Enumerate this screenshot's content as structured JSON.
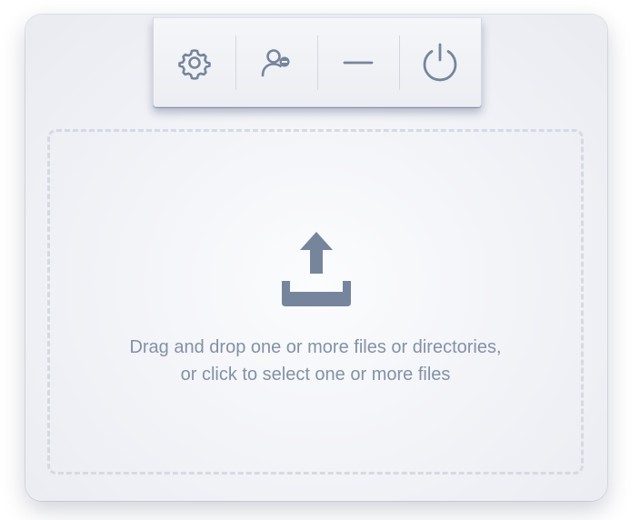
{
  "toolbar": {
    "buttons": [
      {
        "name": "settings",
        "icon": "gear-icon"
      },
      {
        "name": "account",
        "icon": "user-status-icon"
      },
      {
        "name": "minimize",
        "icon": "minus-icon"
      },
      {
        "name": "quit",
        "icon": "power-icon"
      }
    ]
  },
  "dropzone": {
    "icon": "upload-icon",
    "line1": "Drag and drop one or more files or directories,",
    "line2": "or click to select one or more files"
  },
  "colors": {
    "icon": "#76859c",
    "text": "#8391a6",
    "dash": "#d5d9e2"
  }
}
